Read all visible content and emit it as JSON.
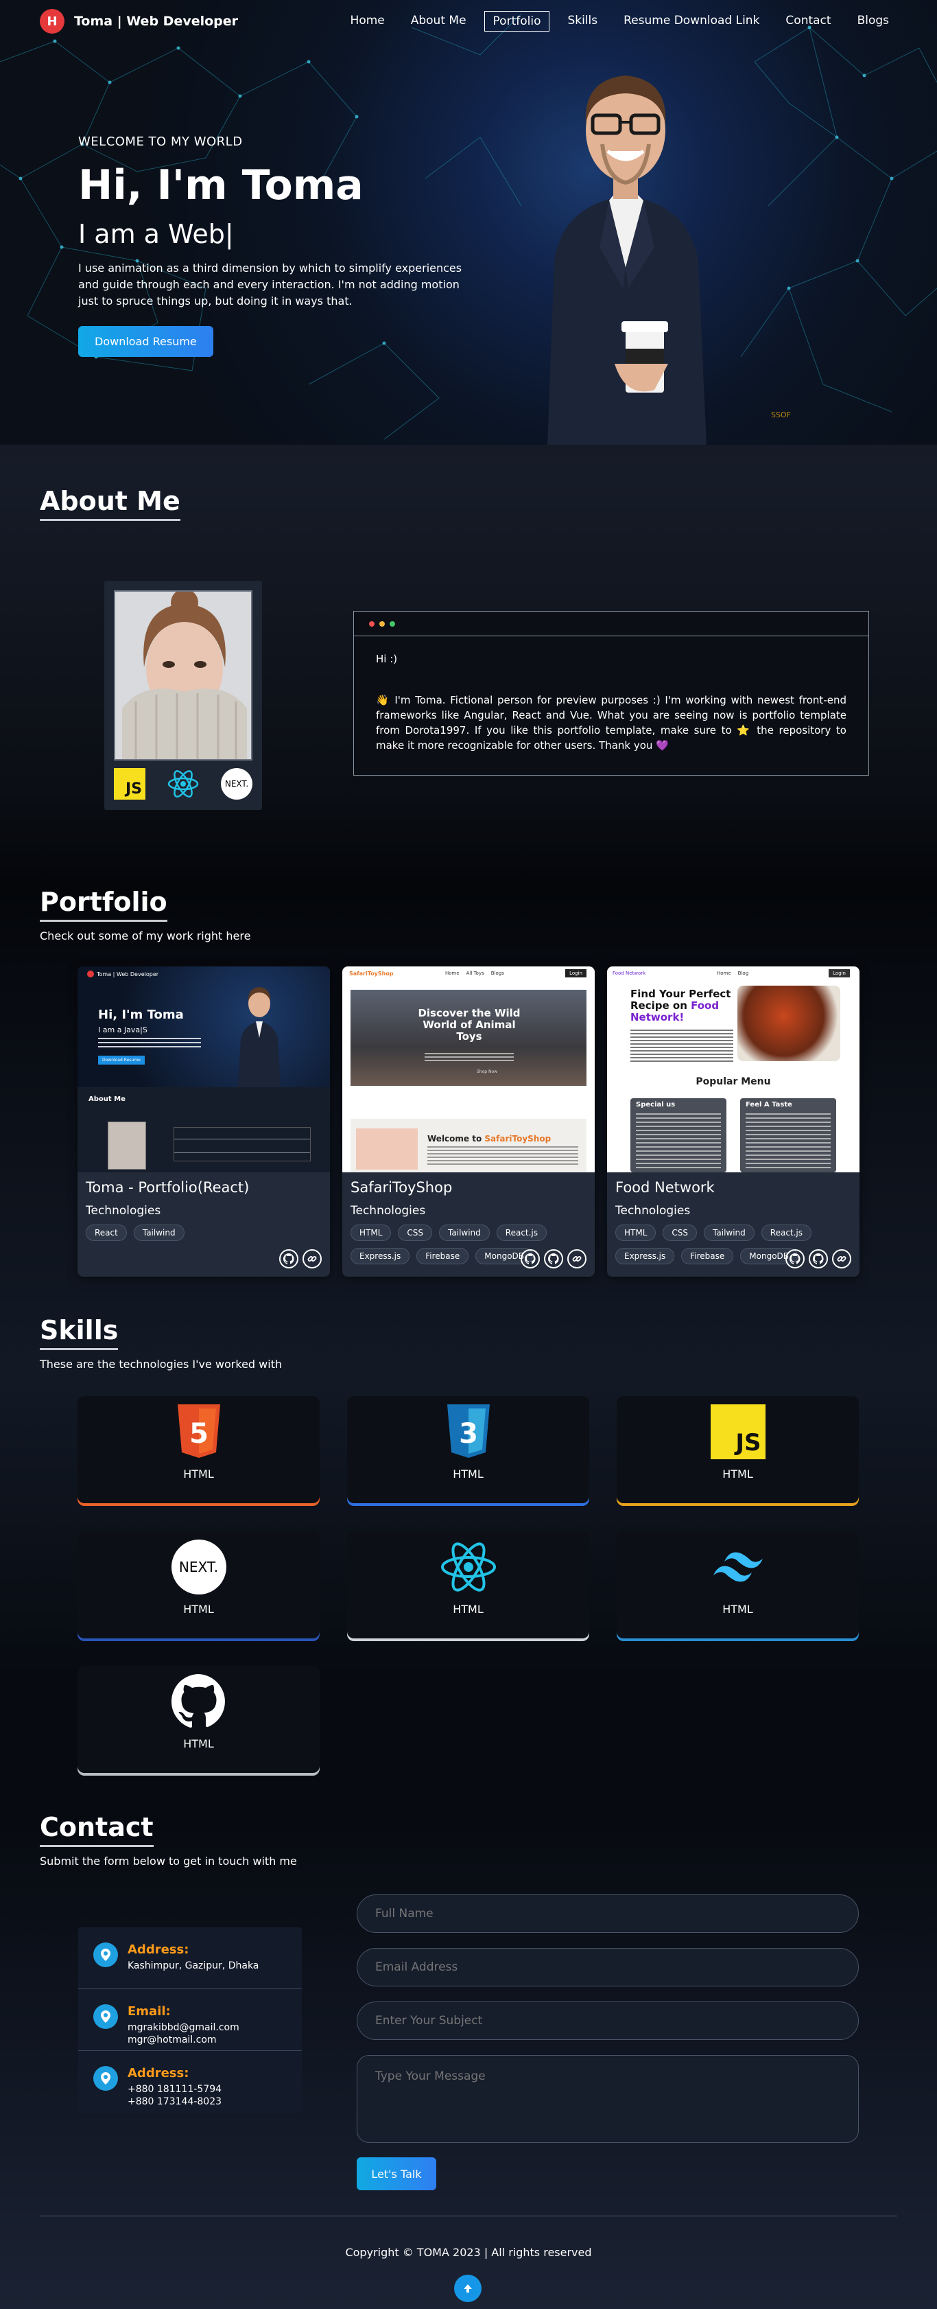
{
  "nav": {
    "logo_letter": "H",
    "brand": "Toma  | Web Developer",
    "items": [
      "Home",
      "About Me",
      "Portfolio",
      "Skills",
      "Resume Download Link",
      "Contact",
      "Blogs"
    ]
  },
  "hero": {
    "welcome": "WELCOME TO MY WORLD",
    "greeting": "Hi, I'm Toma",
    "role": "I am a Web|",
    "description": "I use animation as a third dimension by which to simplify experiences and guide through each and every interaction. I'm not adding motion just to spruce things up, but doing it in ways that.",
    "button": "Download Resume",
    "footnote": "SSOF"
  },
  "about": {
    "title": "About Me",
    "js_label": "JS",
    "next_label": "NEXT.",
    "greeting": "Hi :)",
    "bio": "👋  I'm Toma. Fictional person for preview purposes :) I'm working with newest front-end frameworks like Angular, React and Vue. What you are seeing now is portfolio template from Dorota1997. If you like this portfolio template, make sure to ⭐ the repository to make it more recognizable for other users. Thank you 💜"
  },
  "portfolio": {
    "title": "Portfolio",
    "subtitle": "Check out some of my work right here",
    "tech_heading": "Technologies",
    "cards": [
      {
        "title": "Toma - Portfolio(React)",
        "tags": [
          "React",
          "Tailwind"
        ],
        "shot": {
          "brand": "Toma | Web Developer",
          "hi": "Hi, I'm Toma",
          "role": "I am a Java|S",
          "btn": "Download Resume",
          "about": "About Me"
        }
      },
      {
        "title": "SafariToyShop",
        "tags": [
          "HTML",
          "CSS",
          "Tailwind",
          "React.js",
          "Express.js",
          "Firebase",
          "MongoDB"
        ],
        "shot": {
          "brand": "SafariToyShop",
          "links": [
            "Home",
            "All Toys",
            "Blogs"
          ],
          "login": "Login",
          "hero": "Discover the Wild World of Animal Toys",
          "shop_btn": "Shop Now",
          "welcome_pre": "Welcome to ",
          "welcome_brand": "SafariToyShop"
        }
      },
      {
        "title": "Food Network",
        "tags": [
          "HTML",
          "CSS",
          "Tailwind",
          "React.js",
          "Express.js",
          "Firebase",
          "MongoDB"
        ],
        "shot": {
          "brand": "Food Network",
          "links": [
            "Home",
            "Blog"
          ],
          "login": "Login",
          "hero_pre": "Find Your Perfect Recipe on ",
          "hero_brand": "Food Network!",
          "popular": "Popular Menu",
          "menu": [
            "Special us",
            "Feel A Taste"
          ]
        }
      }
    ]
  },
  "skills": {
    "title": "Skills",
    "subtitle": "These are the technologies I've worked with",
    "items": [
      {
        "icon": "html5-icon",
        "name": "HTML",
        "glow": "#e96228"
      },
      {
        "icon": "css3-icon",
        "name": "HTML",
        "glow": "#2f6fe0"
      },
      {
        "icon": "javascript-icon",
        "name": "HTML",
        "glow": "#e6a21c"
      },
      {
        "icon": "nextjs-icon",
        "name": "HTML",
        "glow": "#2a55b8"
      },
      {
        "icon": "react-icon",
        "name": "HTML",
        "glow": "#cfd3da"
      },
      {
        "icon": "tailwind-icon",
        "name": "HTML",
        "glow": "#2a8fd2"
      },
      {
        "icon": "github-icon",
        "name": "HTML",
        "glow": "#b8bcc4"
      }
    ],
    "js_label": "JS",
    "html_label": "5",
    "css_label": "3",
    "next_label": "NEXT."
  },
  "contact": {
    "title": "Contact",
    "subtitle": "Submit the form below to get in touch with me",
    "info": [
      {
        "label": "Address:",
        "lines": [
          "Kashimpur, Gazipur, Dhaka"
        ]
      },
      {
        "label": "Email:",
        "lines": [
          "mgrakibbd@gmail.com",
          "mgr@hotmail.com"
        ]
      },
      {
        "label": "Address:",
        "lines": [
          "+880 181111-5794",
          "+880 173144-8023"
        ]
      }
    ],
    "placeholders": {
      "name": "Full Name",
      "email": "Email Address",
      "subject": "Enter Your Subject",
      "message": "Type Your Message"
    },
    "button": "Let's Talk"
  },
  "footer": {
    "copyright": "Copyright © TOMA 2023 | All rights reserved",
    "top_icon": "arrow-up-icon"
  },
  "colors": {
    "accent": "#1fa0e0",
    "logo_red": "#e5393b",
    "contact_label": "#ff9a1a"
  }
}
